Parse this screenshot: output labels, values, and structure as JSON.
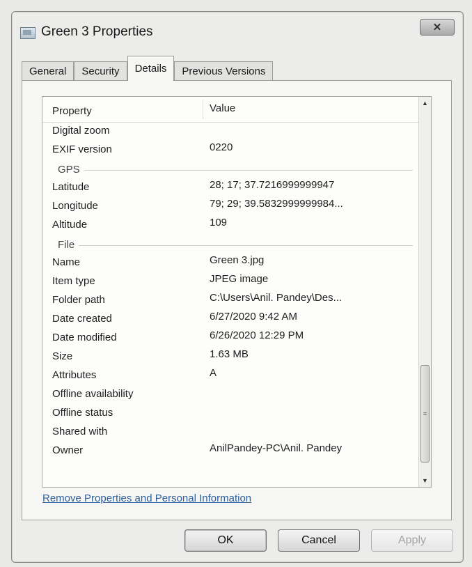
{
  "window": {
    "title": "Green 3 Properties",
    "close_glyph": "✕"
  },
  "tabs": [
    {
      "label": "General",
      "active": false
    },
    {
      "label": "Security",
      "active": false
    },
    {
      "label": "Details",
      "active": true
    },
    {
      "label": "Previous Versions",
      "active": false
    }
  ],
  "details": {
    "header_property": "Property",
    "header_value": "Value",
    "rows": [
      {
        "type": "row",
        "label": "Digital zoom",
        "value": ""
      },
      {
        "type": "row",
        "label": "EXIF version",
        "value": "0220"
      },
      {
        "type": "group",
        "label": "GPS"
      },
      {
        "type": "row",
        "label": "Latitude",
        "value": "28; 17; 37.7216999999947"
      },
      {
        "type": "row",
        "label": "Longitude",
        "value": "79; 29; 39.5832999999984..."
      },
      {
        "type": "row",
        "label": "Altitude",
        "value": "109"
      },
      {
        "type": "group",
        "label": "File"
      },
      {
        "type": "row",
        "label": "Name",
        "value": "Green 3.jpg"
      },
      {
        "type": "row",
        "label": "Item type",
        "value": "JPEG image"
      },
      {
        "type": "row",
        "label": "Folder path",
        "value": "C:\\Users\\Anil. Pandey\\Des..."
      },
      {
        "type": "row",
        "label": "Date created",
        "value": "6/27/2020 9:42 AM"
      },
      {
        "type": "row",
        "label": "Date modified",
        "value": "6/26/2020 12:29 PM"
      },
      {
        "type": "row",
        "label": "Size",
        "value": "1.63 MB"
      },
      {
        "type": "row",
        "label": "Attributes",
        "value": "A"
      },
      {
        "type": "row",
        "label": "Offline availability",
        "value": ""
      },
      {
        "type": "row",
        "label": "Offline status",
        "value": ""
      },
      {
        "type": "row",
        "label": "Shared with",
        "value": ""
      },
      {
        "type": "row",
        "label": "Owner",
        "value": "AnilPandey-PC\\Anil. Pandey"
      }
    ]
  },
  "remove_link": "Remove Properties and Personal Information",
  "buttons": {
    "ok": "OK",
    "cancel": "Cancel",
    "apply": "Apply"
  },
  "icons": {
    "scroll_up": "▲",
    "scroll_down": "▼",
    "thumb_grip": "≡"
  }
}
